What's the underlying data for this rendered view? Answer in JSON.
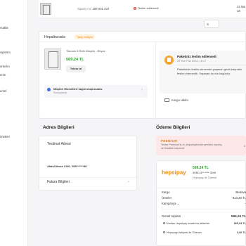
{
  "sidebar": {
    "items": [
      "rsatlar",
      "siplerim",
      "imlerim",
      "erim",
      "eriml",
      "imetleri"
    ]
  },
  "order": {
    "number_label": "Sipariş no:",
    "number": "206 001 037",
    "status": "Teslim edilemedi",
    "status_icon": "x",
    "date_line1": "22 Ma",
    "date_line2": "18",
    "button": "S"
  },
  "card": {
    "seller": "Hepsiburada",
    "seller_badge": "Takip ediliyor",
    "product_name": "Tiamolo 5 Raflı Kitaplık - Beyaz",
    "product_price": "569,24 TL",
    "repeat_button": "Tekrar al",
    "mh_title": "Müşteri Hizmetleri kaydı oluşturuldu.",
    "mh_sub": "Sonuçlandı",
    "pk_title": "Paketiniz teslim edilemedi",
    "pk_date": "29 Tem Paz 2024, 16:17",
    "pk_desc": "Paketinizin teslim sürecinde yaşanan gecik kaynaklı teslim edemedik. Yaşanan bu dur üzgünüz.",
    "kargo": "Kargo takibi"
  },
  "address": {
    "section_title": "Adres Bilgileri",
    "title": "Teslimat Adresi",
    "name": "Abdül Mesut CAN - 905*******88",
    "fatura": "Fatura Bilgileri"
  },
  "payment": {
    "section_title": "Ödeme Bilgileri",
    "premium_title": "PREMIUM",
    "premium_text": "Tekrar Premium'lu ol, alışverişlerinde yeniden kazanç ve fırsatları kaçırma!",
    "premium_num": "2",
    "logo": "hepsipay",
    "amount": "569,24 TL",
    "card_no": "4938 41** **** 3249",
    "method": "Hepsipay ile Ödendi",
    "rows": [
      {
        "label": "Kargo",
        "value": "Bedava"
      },
      {
        "label": "Ürünler",
        "value": "813,20 TL"
      },
      {
        "label": "Kampanya",
        "value": "-"
      }
    ],
    "total_label": "Genel toplam",
    "total_value": "569,24 TL",
    "sub_rows": [
      {
        "label": "Kartları Hepsipay hesabına aktarılan",
        "value": "565,64 TL"
      },
      {
        "label": "Hepsipay bakiyesi ile Ödenen",
        "value": "3,60 TL"
      }
    ]
  }
}
